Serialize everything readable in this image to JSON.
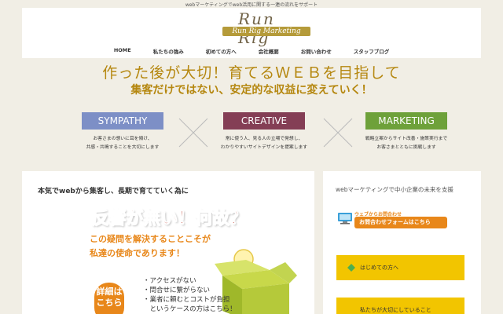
{
  "site": {
    "tagline": "webマーケティングでweb活用に関する一連の流れをサポート",
    "logo_script": "Run Rig",
    "logo_text": "Run Rig Marketing"
  },
  "nav": {
    "items": [
      "HOME",
      "私たちの強み",
      "初めての方へ",
      "会社概要",
      "お問い合わせ",
      "スタッフブログ"
    ]
  },
  "hero": {
    "line1": "作った後が大切！育てるＷＥＢを目指して",
    "line2": "集客だけではない、安定的な収益に変えていく！",
    "pillars": [
      {
        "label": "SYMPATHY",
        "color": "#7d8fc6",
        "desc1": "お客さまの想いに耳を傾け、",
        "desc2": "共感・共鳴することを大切にします"
      },
      {
        "label": "CREATIVE",
        "color": "#843e55",
        "desc1": "常に使う人、見る人の立場で発想し、",
        "desc2": "わかりやすいサイトデザインを提案します"
      },
      {
        "label": "MARKETING",
        "color": "#6ea13a",
        "desc1": "戦略立案からサイト改善・施策実行まで",
        "desc2": "お客さまとともに挑戦します"
      }
    ]
  },
  "main": {
    "heading": "本気でwebから集客し、長期で育てていく為に",
    "ad_headline": "反響が無い！何故？",
    "ad_line1": "この疑問を解決することこそが",
    "ad_line2": "私達の使命であります！",
    "badge_line1": "詳細は",
    "badge_line2": "こちら",
    "checks": [
      "・アクセスがない",
      "・問合せに繋がらない",
      "・業者に頼むとコストが負担",
      "　というケースの方はこちら！"
    ]
  },
  "sidebar": {
    "title": "webマーケティングで中小企業の未来を支援",
    "contact_small": "ウェブからお問合わせ",
    "contact_button": "お問合わせフォームはこちら",
    "button1": "はじめての方へ",
    "button2": "私たちが大切にしていること"
  },
  "colors": {
    "accent_gold": "#b5870f",
    "orange": "#e8871a",
    "yellow": "#f2c500"
  }
}
